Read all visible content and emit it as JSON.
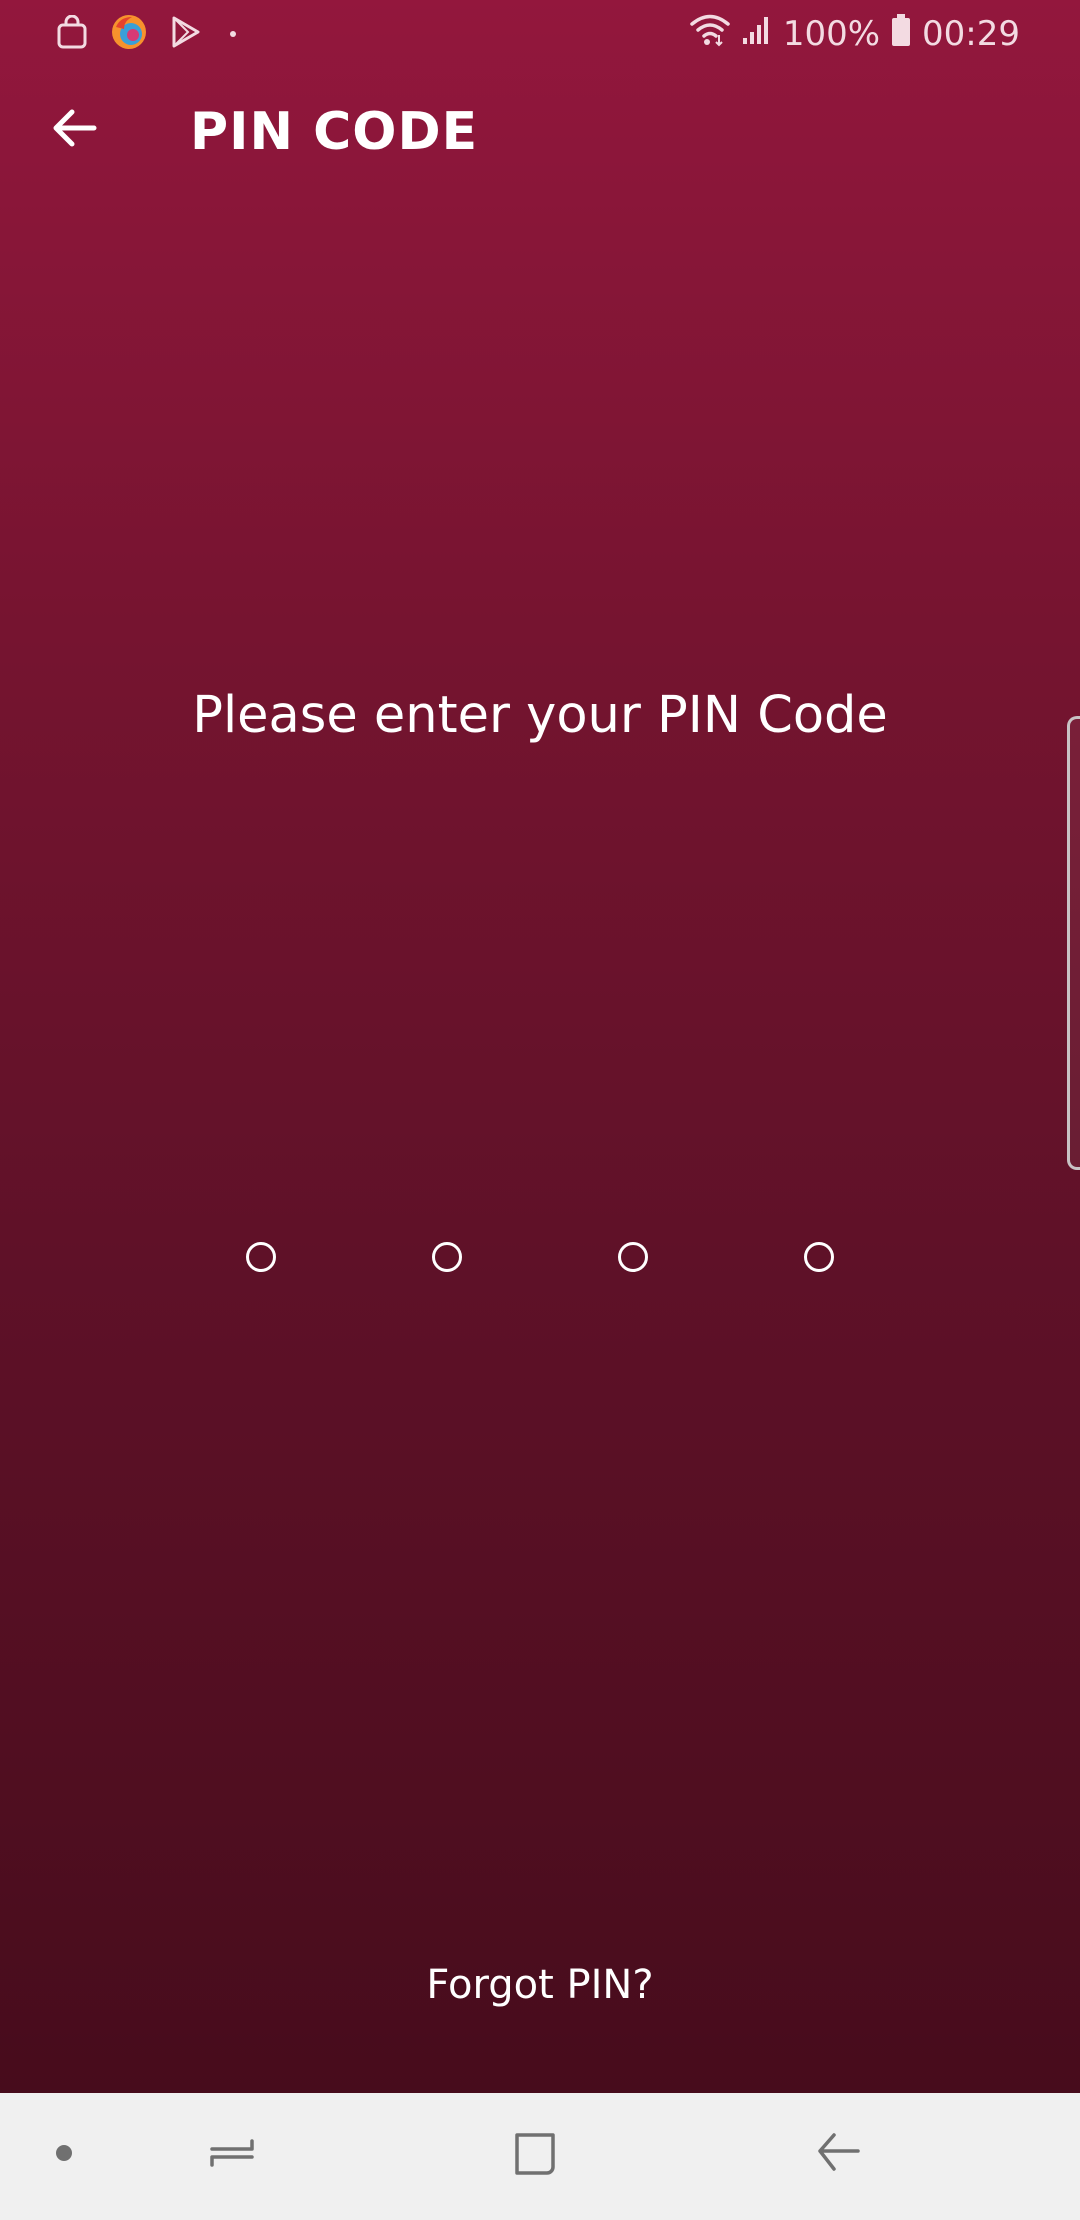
{
  "status_bar": {
    "battery_percent": "100%",
    "time": "00:29",
    "notification_icons": [
      "shopping-bag-icon",
      "firefox-icon",
      "play-store-icon",
      "more-notifications-dot"
    ],
    "system_icons": [
      "wifi-icon",
      "signal-icon",
      "battery-icon"
    ]
  },
  "header": {
    "title": "PIN CODE",
    "back_icon": "arrow-left-icon"
  },
  "main": {
    "prompt": "Please enter your PIN Code",
    "pin_length": 4,
    "pin_entered": 0,
    "forgot_pin_label": "Forgot PIN?"
  },
  "nav_bar": {
    "items": [
      "dot-icon",
      "recent-apps-icon",
      "home-icon",
      "back-icon"
    ]
  },
  "colors": {
    "gradient_top": "#93173d",
    "gradient_bottom": "#470c1c",
    "text": "#ffffff",
    "nav_background": "#f0f0f0"
  }
}
